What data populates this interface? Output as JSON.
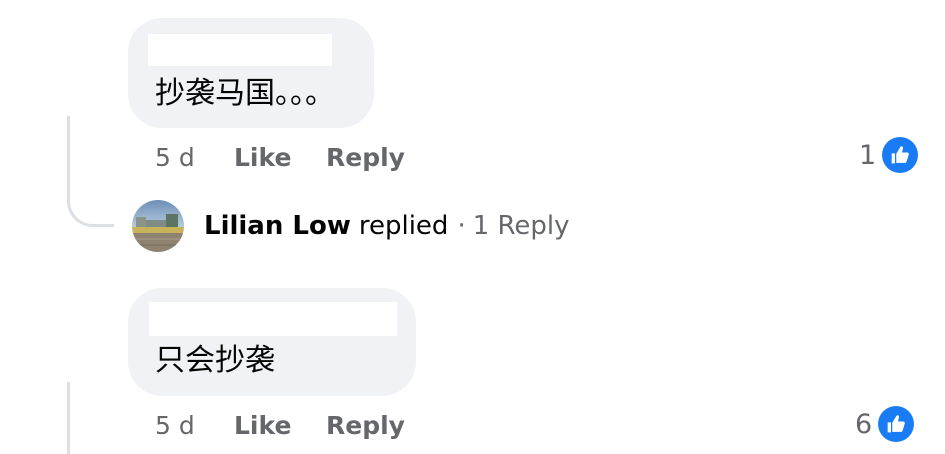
{
  "comments": [
    {
      "text": "抄袭马国。。。",
      "age": "5 d",
      "like_label": "Like",
      "reply_label": "Reply",
      "reactions": "1"
    },
    {
      "text": "只会抄袭",
      "age": "5 d",
      "like_label": "Like",
      "reply_label": "Reply",
      "reactions": "6"
    }
  ],
  "reply_summary": {
    "name": "Lilian Low",
    "verb": "replied",
    "separator": "·",
    "count_label": "1 Reply"
  },
  "icons": {
    "reaction": "thumbs-up-icon",
    "avatar": "avatar-photo"
  },
  "colors": {
    "bubble": "#f0f2f5",
    "muted_text": "#65676b",
    "primary_text": "#050505",
    "like_blue": "#1a7cf5",
    "thread_line": "#dcdfe4"
  }
}
